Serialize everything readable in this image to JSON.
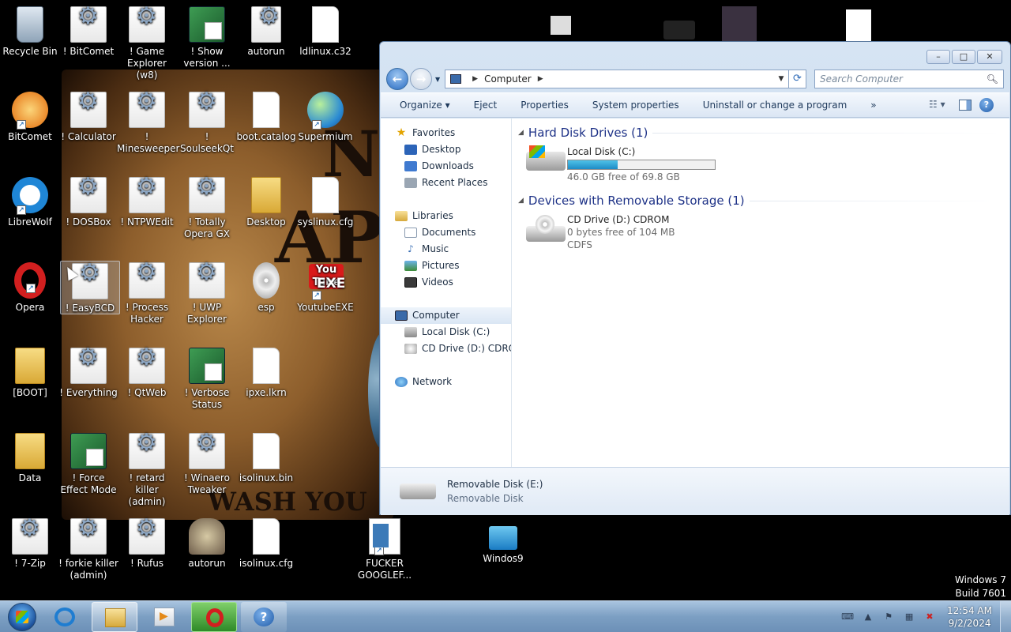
{
  "desktop": {
    "icons": [
      {
        "label": "Recycle Bin"
      },
      {
        "label": "! BitComet"
      },
      {
        "label": "! Game Explorer (w8)"
      },
      {
        "label": "! Show version ..."
      },
      {
        "label": "autorun"
      },
      {
        "label": "ldlinux.c32"
      },
      {
        "label": "BitComet"
      },
      {
        "label": "! Calculator"
      },
      {
        "label": "! Minesweeper"
      },
      {
        "label": "! SoulseekQt"
      },
      {
        "label": "boot.catalog"
      },
      {
        "label": "Supermium"
      },
      {
        "label": "LibreWolf"
      },
      {
        "label": "! DOSBox"
      },
      {
        "label": "! NTPWEdit"
      },
      {
        "label": "! Totally Opera GX"
      },
      {
        "label": "Desktop"
      },
      {
        "label": "syslinux.cfg"
      },
      {
        "label": "Opera"
      },
      {
        "label": "! EasyBCD"
      },
      {
        "label": "! Process Hacker"
      },
      {
        "label": "! UWP Explorer"
      },
      {
        "label": "esp"
      },
      {
        "label": "YoutubeEXE"
      },
      {
        "label": "[BOOT]"
      },
      {
        "label": "! Everything"
      },
      {
        "label": "! QtWeb"
      },
      {
        "label": "! Verbose Status"
      },
      {
        "label": "ipxe.lkrn"
      },
      {
        "label": "Data"
      },
      {
        "label": "! Force Effect Mode"
      },
      {
        "label": "! retard killer (admin)"
      },
      {
        "label": "! Winaero Tweaker"
      },
      {
        "label": "isolinux.bin"
      },
      {
        "label": "! 7-Zip"
      },
      {
        "label": "! forkie killer (admin)"
      },
      {
        "label": "! Rufus"
      },
      {
        "label": "autorun"
      },
      {
        "label": "isolinux.cfg"
      },
      {
        "label": "FUCKER GOOGLEF..."
      },
      {
        "label": "Windos9"
      }
    ],
    "youtube_logo_text": "You Tube",
    "exe_text": "EXE",
    "wallpaper_text": {
      "line1": "N",
      "line2": "AP",
      "line3": "WASH YOU"
    },
    "os_name": "Windows 7",
    "os_build": "Build 7601"
  },
  "explorer": {
    "window_controls": {
      "minimize": "–",
      "maximize": "□",
      "close": "✕"
    },
    "address": {
      "location": "Computer"
    },
    "search_placeholder": "Search Computer",
    "toolbar": {
      "organize": "Organize",
      "eject": "Eject",
      "properties": "Properties",
      "system_properties": "System properties",
      "uninstall": "Uninstall or change a program",
      "more": "»"
    },
    "nav": {
      "favorites": "Favorites",
      "desktop": "Desktop",
      "downloads": "Downloads",
      "recent_places": "Recent Places",
      "libraries": "Libraries",
      "documents": "Documents",
      "music": "Music",
      "pictures": "Pictures",
      "videos": "Videos",
      "computer": "Computer",
      "local_disk": "Local Disk (C:)",
      "cd_drive": "CD Drive (D:) CDROM",
      "network": "Network"
    },
    "groups": {
      "hdd": "Hard Disk Drives (1)",
      "removable": "Devices with Removable Storage (1)"
    },
    "drives": {
      "c": {
        "name": "Local Disk (C:)",
        "free": "46.0 GB free of 69.8 GB",
        "used_fraction": 0.34
      },
      "d": {
        "name": "CD Drive (D:) CDROM",
        "free": "0 bytes free of 104 MB",
        "fs": "CDFS"
      }
    },
    "details": {
      "name": "Removable Disk (E:)",
      "type": "Removable Disk"
    }
  },
  "taskbar": {
    "clock_time": "12:54 AM",
    "clock_date": "9/2/2024"
  }
}
